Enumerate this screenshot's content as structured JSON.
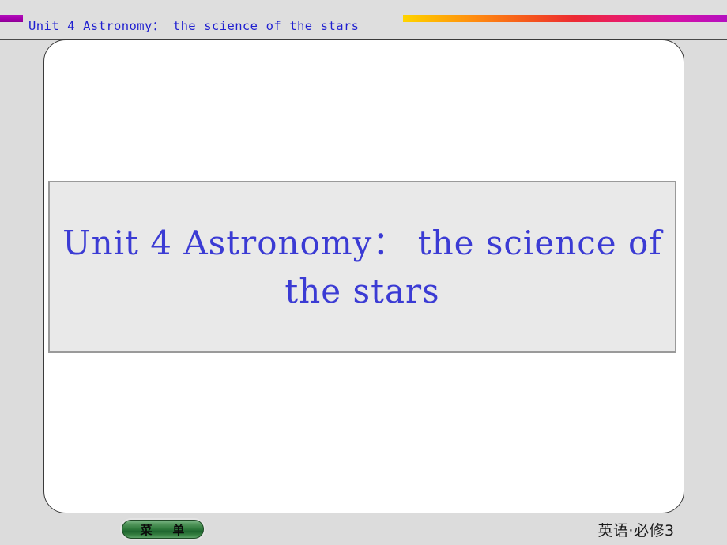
{
  "header": {
    "title": "Unit 4  Astronomy： the science of the stars",
    "left_swatch_color": "#a800b0",
    "gradient_colors": [
      "#ffd400",
      "#ff8c10",
      "#ec2a33",
      "#e81b6b",
      "#b410c0"
    ],
    "rule_color": "#4a4a4a"
  },
  "slide": {
    "background_color": "#dcdcdc",
    "frame_background": "#ffffff",
    "frame_border_color": "#3a3a3a"
  },
  "title_panel": {
    "text": "Unit 4  Astronomy： the science of the stars",
    "text_color": "#3b3bd4",
    "background_color": "#e9e9e9",
    "border_color": "#9a9a9a"
  },
  "footer": {
    "menu_button_label": "菜    单",
    "menu_button_color": "#2f7a3c",
    "note": "英语·必修3"
  }
}
